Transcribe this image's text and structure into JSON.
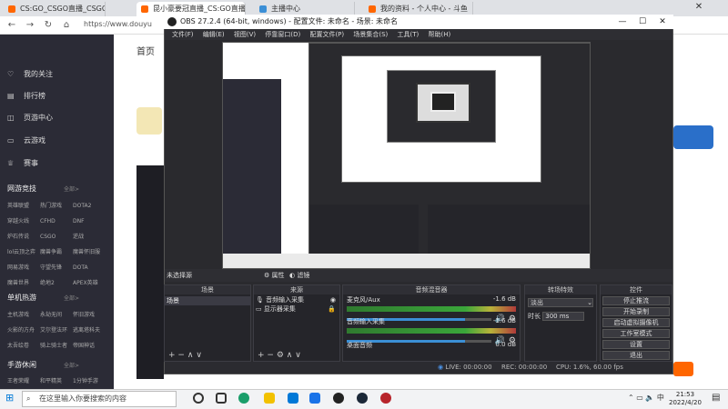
{
  "browser": {
    "tabs": [
      {
        "title": "CS:GO_CSGO直播_CSGO直播间"
      },
      {
        "title": "昆小豪要冠直播_CS:GO直播_斗鱼"
      },
      {
        "title": "主播中心"
      },
      {
        "title": "我的资料 - 个人中心 - 斗鱼"
      }
    ],
    "url": "https://www.douyu"
  },
  "site": {
    "logo_text": "斗鱼",
    "nav_home": "首页",
    "sidebar": {
      "main_items": [
        {
          "icon": "heart-icon",
          "label": "我的关注"
        },
        {
          "icon": "ranking-icon",
          "label": "排行榜"
        },
        {
          "icon": "page-center-icon",
          "label": "页游中心"
        },
        {
          "icon": "cloud-game-icon",
          "label": "云游戏"
        },
        {
          "icon": "trophy-icon",
          "label": "赛事"
        }
      ],
      "sections": [
        {
          "title": "网游竞技",
          "more": "全部>",
          "items": [
            "英雄联盟",
            "热门游戏",
            "DOTA2",
            "穿越火线",
            "CFHD",
            "DNF",
            "炉石传说",
            "CSGO",
            "逆战",
            "lol云顶之弈",
            "魔兽争霸",
            "魔兽怀旧服",
            "网易游戏",
            "守望先锋",
            "DOTA",
            "魔兽世界",
            "绝地2",
            "APEX英雄"
          ]
        },
        {
          "title": "单机热游",
          "more": "全部>",
          "items": [
            "主机游戏",
            "永劫无间",
            "怀旧游戏",
            "火影的方舟",
            "艾尔登法环",
            "逃离塔科夫",
            "太吾绘卷",
            "骑上骑士者",
            "帝国神话"
          ]
        },
        {
          "title": "手游休闲",
          "more": "全部>",
          "items": [
            "王者荣耀",
            "和平精英",
            "1分钟手游"
          ]
        }
      ]
    }
  },
  "obs": {
    "title": "OBS 27.2.4 (64-bit, windows) - 配置文件: 未命名 - 场景: 未命名",
    "menu": [
      "文件(F)",
      "编辑(E)",
      "视图(V)",
      "停靠窗口(D)",
      "配置文件(P)",
      "场景集合(S)",
      "工具(T)",
      "帮助(H)"
    ],
    "no_source_selected": "未选择源",
    "properties_btn": "属性",
    "filters_btn": "滤镜",
    "scenes": {
      "header": "场景",
      "items": [
        "场景"
      ]
    },
    "sources": {
      "header": "来源",
      "items": [
        {
          "icon": "microphone-icon",
          "label": "音频输入采集"
        },
        {
          "icon": "monitor-icon",
          "label": "显示器采集"
        }
      ]
    },
    "mixer": {
      "header": "音频混音器",
      "channels": [
        {
          "name": "麦克风/Aux",
          "db": "-1.6 dB",
          "level": 0.82
        },
        {
          "name": "音频输入采集",
          "db": "-1.6 dB",
          "level": 0.82
        },
        {
          "name": "桌面音频",
          "db": "0.0 dB",
          "level": 0.0
        }
      ]
    },
    "transitions": {
      "header": "转场特效",
      "selected": "淡出",
      "duration_label": "时长",
      "duration": "300 ms"
    },
    "controls": {
      "header": "控件",
      "buttons": [
        "停止推流",
        "开始录制",
        "启动虚拟摄像机",
        "工作室模式",
        "设置",
        "退出"
      ]
    },
    "status": {
      "live": "LIVE: 00:00:00",
      "rec": "REC: 00:00:00",
      "cpu": "CPU: 1.6%, 60.00 fps"
    }
  },
  "taskbar": {
    "search_placeholder": "在这里输入你要搜索的内容",
    "time": "21:53",
    "date": "2022/4/20"
  },
  "colors": {
    "site_sidebar": "#2b2b36",
    "obs_bg": "#2a2a2e",
    "douyu_orange": "#ff6600",
    "accent_blue": "#3b8fd6"
  }
}
